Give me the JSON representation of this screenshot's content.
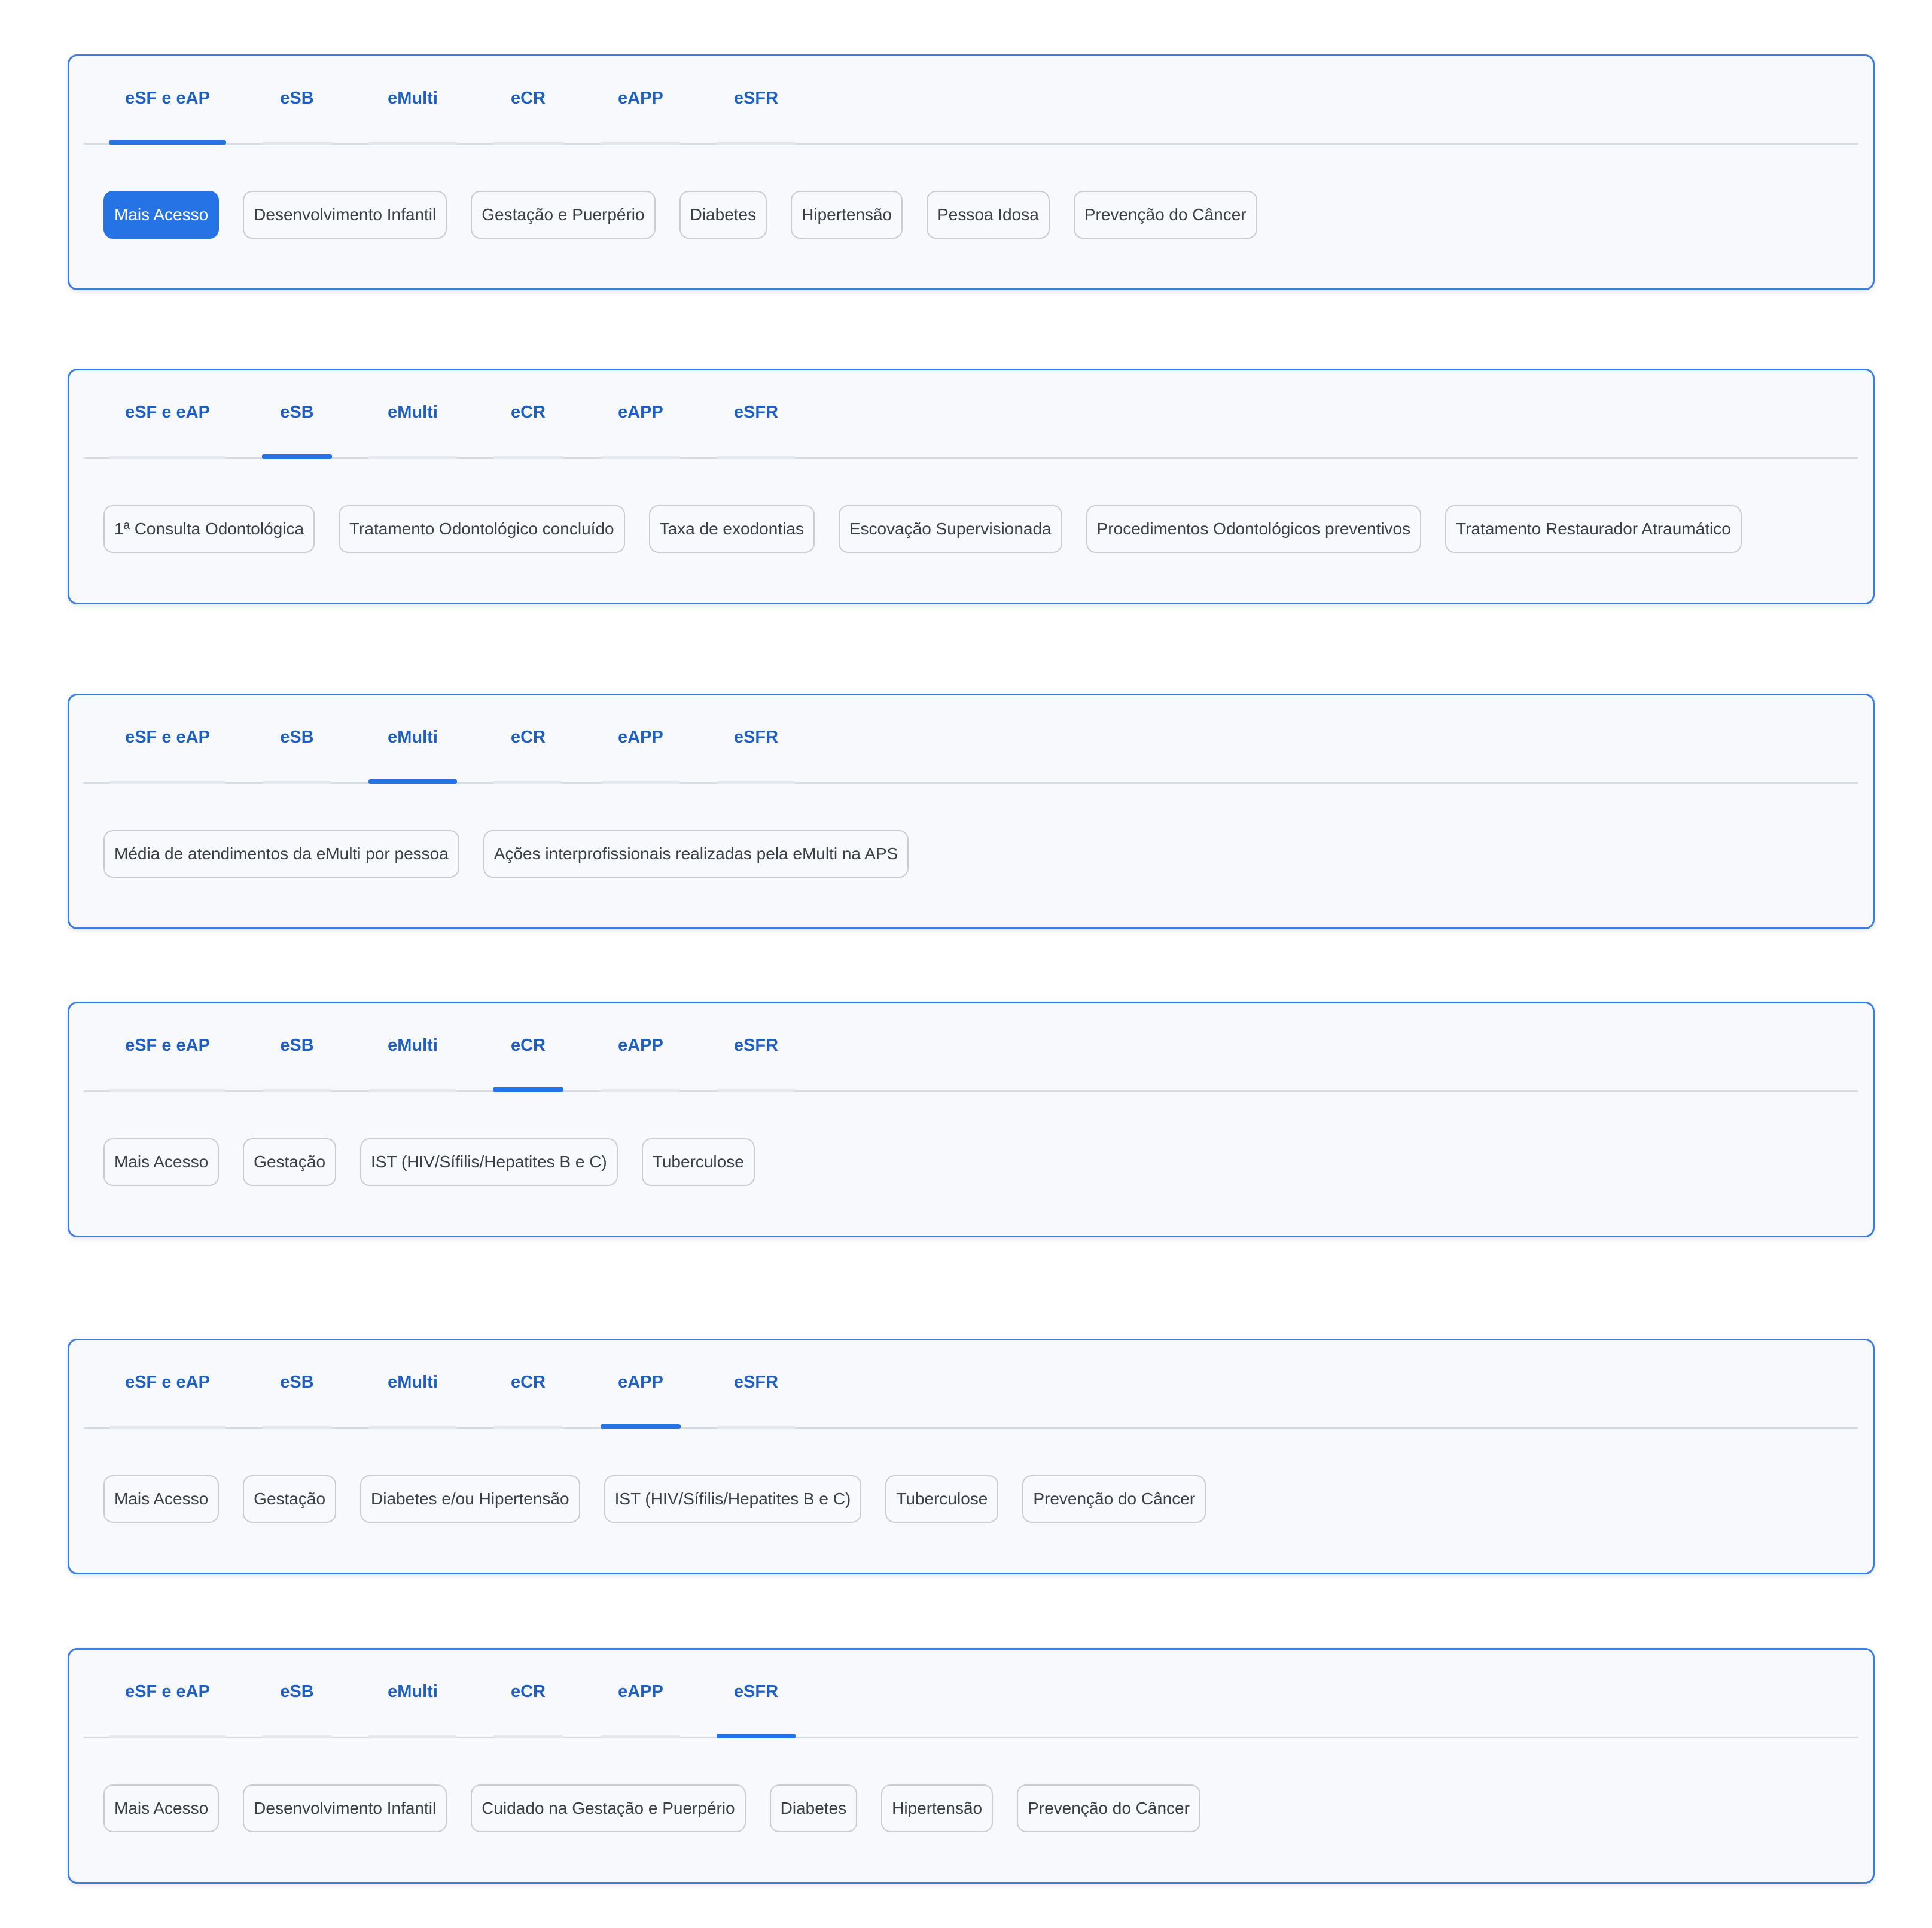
{
  "tabs": [
    "eSF e eAP",
    "eSB",
    "eMulti",
    "eCR",
    "eAPP",
    "eSFR"
  ],
  "panels": [
    {
      "active_tab": 0,
      "active_chip": 0,
      "chips": [
        "Mais Acesso",
        "Desenvolvimento Infantil",
        "Gestação e Puerpério",
        "Diabetes",
        "Hipertensão",
        "Pessoa Idosa",
        "Prevenção do Câncer"
      ]
    },
    {
      "active_tab": 1,
      "active_chip": -1,
      "chips": [
        "1ª Consulta Odontológica",
        "Tratamento Odontológico concluído",
        "Taxa de exodontias",
        "Escovação Supervisionada",
        "Procedimentos Odontológicos preventivos",
        "Tratamento Restaurador Atraumático"
      ]
    },
    {
      "active_tab": 2,
      "active_chip": -1,
      "chips": [
        "Média de atendimentos da eMulti por pessoa",
        "Ações interprofissionais realizadas pela eMulti na APS"
      ]
    },
    {
      "active_tab": 3,
      "active_chip": -1,
      "chips": [
        "Mais Acesso",
        "Gestação",
        "IST (HIV/Sífilis/Hepatites B e C)",
        "Tuberculose"
      ]
    },
    {
      "active_tab": 4,
      "active_chip": -1,
      "chips": [
        "Mais Acesso",
        "Gestação",
        "Diabetes e/ou Hipertensão",
        "IST (HIV/Sífilis/Hepatites B e C)",
        "Tuberculose",
        "Prevenção do Câncer"
      ]
    },
    {
      "active_tab": 5,
      "active_chip": -1,
      "chips": [
        "Mais Acesso",
        "Desenvolvimento Infantil",
        "Cuidado na Gestação e Puerpério",
        "Diabetes",
        "Hipertensão",
        "Prevenção do Câncer"
      ]
    }
  ],
  "colors": {
    "accent": "#2673e6",
    "tab_text": "#1f5fbf",
    "panel_border": "#3d7de0",
    "panel_bg": "#f7f9fc",
    "chip_border": "#c9ccd3"
  }
}
